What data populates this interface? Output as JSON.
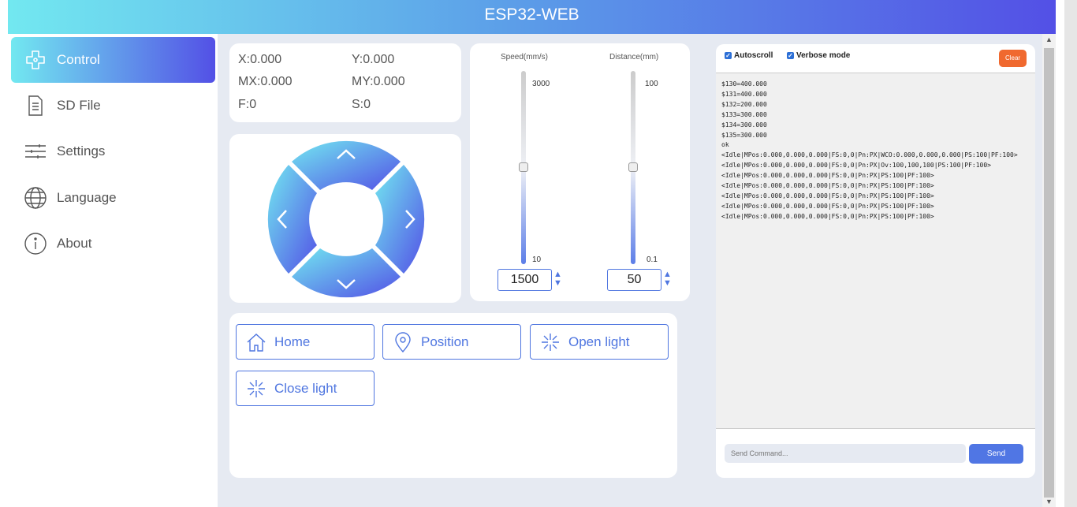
{
  "header": {
    "title": "ESP32-WEB"
  },
  "sidebar": {
    "items": [
      {
        "label": "Control",
        "icon": "gamepad-icon"
      },
      {
        "label": "SD File",
        "icon": "file-icon"
      },
      {
        "label": "Settings",
        "icon": "sliders-icon"
      },
      {
        "label": "Language",
        "icon": "globe-icon"
      },
      {
        "label": "About",
        "icon": "info-icon"
      }
    ]
  },
  "coords": {
    "x": "X:0.000",
    "y": "Y:0.000",
    "mx": "MX:0.000",
    "my": "MY:0.000",
    "f": "F:0",
    "s": "S:0"
  },
  "speed": {
    "label": "Speed(mm/s)",
    "max": "3000",
    "min": "10",
    "value": "1500",
    "fraction": 0.5
  },
  "distance": {
    "label": "Distance(mm)",
    "max": "100",
    "min": "0.1",
    "value": "50",
    "fraction": 0.5
  },
  "actions": [
    "Home",
    "Position",
    "Open light",
    "Close light"
  ],
  "console": {
    "autoscroll": "Autoscroll",
    "verbose": "Verbose mode",
    "clear": "Clear",
    "placeholder": "Send Command...",
    "send": "Send",
    "lines": [
      "$130=400.000",
      "$131=400.000",
      "$132=200.000",
      "$133=300.000",
      "$134=300.000",
      "$135=300.000",
      "ok",
      "<Idle|MPos:0.000,0.000,0.000|FS:0,0|Pn:PX|WCO:0.000,0.000,0.000|PS:100|PF:100>",
      "<Idle|MPos:0.000,0.000,0.000|FS:0,0|Pn:PX|Ov:100,100,100|PS:100|PF:100>",
      "<Idle|MPos:0.000,0.000,0.000|FS:0,0|Pn:PX|PS:100|PF:100>",
      "<Idle|MPos:0.000,0.000,0.000|FS:0,0|Pn:PX|PS:100|PF:100>",
      "<Idle|MPos:0.000,0.000,0.000|FS:0,0|Pn:PX|PS:100|PF:100>",
      "<Idle|MPos:0.000,0.000,0.000|FS:0,0|Pn:PX|PS:100|PF:100>",
      "<Idle|MPos:0.000,0.000,0.000|FS:0,0|Pn:PX|PS:100|PF:100>"
    ]
  }
}
